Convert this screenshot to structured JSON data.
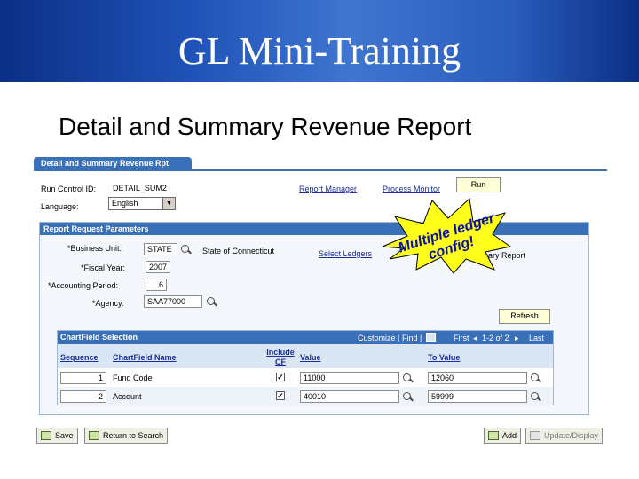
{
  "slide": {
    "title": "GL Mini-Training",
    "heading": "Detail and Summary Revenue Report"
  },
  "page_tab": "Detail and Summary Revenue Rpt",
  "run_control": {
    "label": "Run Control ID:",
    "value": "DETAIL_SUM2",
    "language_label": "Language:",
    "language_value": "English",
    "report_manager": "Report Manager",
    "process_monitor": "Process Monitor",
    "run_button": "Run"
  },
  "params": {
    "title": "Report Request Parameters",
    "business_unit_label": "*Business Unit:",
    "business_unit_value": "STATE",
    "business_unit_desc": "State of Connecticut",
    "fiscal_year_label": "*Fiscal Year:",
    "fiscal_year_value": "2007",
    "period_label": "*Accounting Period:",
    "period_value": "6",
    "agency_label": "*Agency:",
    "agency_value": "SAA77000",
    "select_ledgers": "Select Ledgers",
    "summary_report_label": "Summary Report",
    "summary_report_checked": true,
    "refresh_button": "Refresh"
  },
  "annotation": {
    "text": "Multiple ledger config!",
    "star_color": "#ffff1a"
  },
  "chartfield": {
    "title": "ChartField Selection",
    "customize": "Customize",
    "find": "Find",
    "first": "First",
    "range": "1-2 of 2",
    "last": "Last",
    "columns": [
      "Sequence",
      "ChartField Name",
      "Include CF",
      "Value",
      "To Value"
    ],
    "rows": [
      {
        "sequence": "1",
        "name": "Fund Code",
        "include": true,
        "value": "11000",
        "to_value": "12060"
      },
      {
        "sequence": "2",
        "name": "Account",
        "include": true,
        "value": "40010",
        "to_value": "59999"
      }
    ]
  },
  "footer": {
    "save": "Save",
    "return_to_search": "Return to Search",
    "add": "Add",
    "update_display": "Update/Display"
  },
  "colors": {
    "banner": "#1f53b8",
    "header_blue": "#3a70b8",
    "link_blue": "#1a2f9a"
  }
}
